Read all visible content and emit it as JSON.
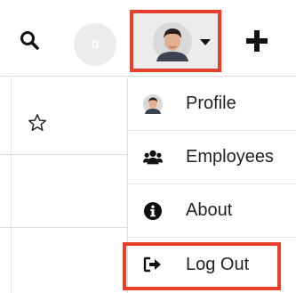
{
  "header": {
    "notification_count": "0",
    "icons": {
      "search": "search-icon",
      "avatar": "user-avatar",
      "caret": "caret-down-icon",
      "add": "plus-icon"
    }
  },
  "list": {
    "favorite_icon": "star-outline-icon"
  },
  "user_menu": {
    "items": [
      {
        "label": "Profile",
        "icon": "user-avatar"
      },
      {
        "label": "Employees",
        "icon": "users-icon"
      },
      {
        "label": "About",
        "icon": "info-circle-icon"
      },
      {
        "label": "Log Out",
        "icon": "sign-out-icon"
      }
    ]
  },
  "colors": {
    "highlight": "#e8402c",
    "button_bg": "#ececec",
    "divider": "#dcdcdc"
  }
}
